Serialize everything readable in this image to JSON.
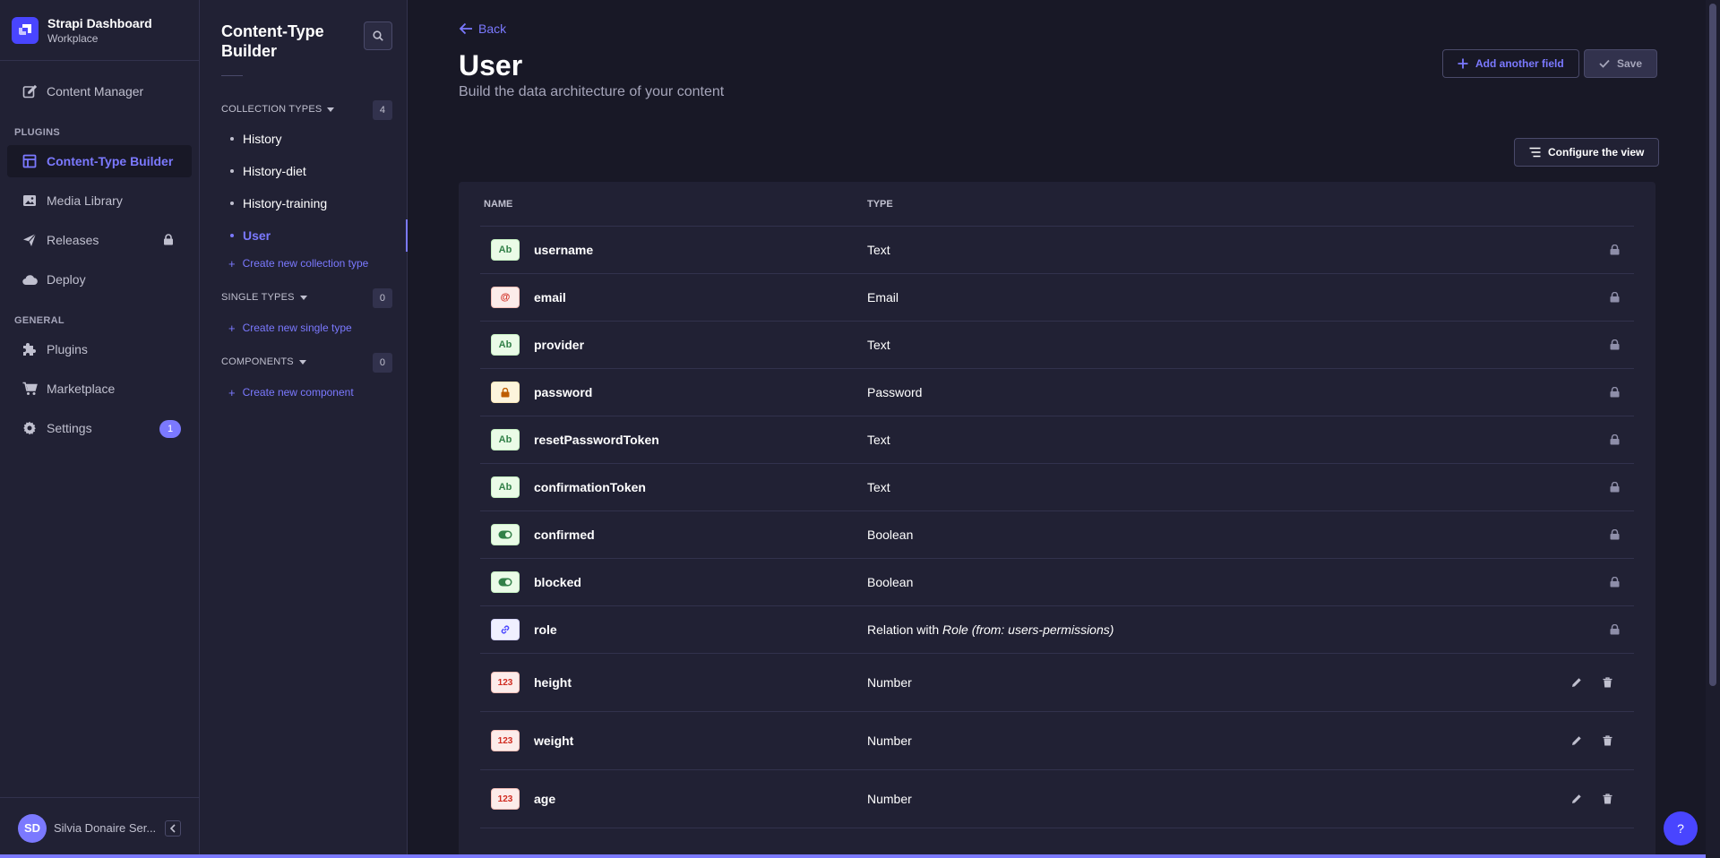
{
  "brand": {
    "title": "Strapi Dashboard",
    "subtitle": "Workplace"
  },
  "main_nav": {
    "content_manager": "Content Manager",
    "plugins_section": "PLUGINS",
    "content_type_builder": "Content-Type Builder",
    "media_library": "Media Library",
    "releases": "Releases",
    "deploy": "Deploy",
    "general_section": "GENERAL",
    "plugins": "Plugins",
    "marketplace": "Marketplace",
    "settings": "Settings",
    "settings_badge": "1"
  },
  "user": {
    "initials": "SD",
    "name": "Silvia Donaire Ser..."
  },
  "sub_nav": {
    "title": "Content-Type Builder",
    "collection_types": {
      "label": "COLLECTION TYPES",
      "count": "4",
      "items": [
        "History",
        "History-diet",
        "History-training",
        "User"
      ],
      "active": "User",
      "create_label": "Create new collection type"
    },
    "single_types": {
      "label": "SINGLE TYPES",
      "count": "0",
      "create_label": "Create new single type"
    },
    "components": {
      "label": "COMPONENTS",
      "count": "0",
      "create_label": "Create new component"
    }
  },
  "header": {
    "back": "Back",
    "title": "User",
    "subtitle": "Build the data architecture of your content",
    "add_field": "Add another field",
    "save": "Save",
    "configure_view": "Configure the view"
  },
  "table": {
    "col_name": "NAME",
    "col_type": "TYPE",
    "rows": [
      {
        "badge": "Ab",
        "kind": "text",
        "name": "username",
        "type": "Text"
      },
      {
        "badge": "@",
        "kind": "email",
        "name": "email",
        "type": "Email"
      },
      {
        "badge": "Ab",
        "kind": "text",
        "name": "provider",
        "type": "Text"
      },
      {
        "badge": "lock",
        "kind": "password",
        "name": "password",
        "type": "Password"
      },
      {
        "badge": "Ab",
        "kind": "text",
        "name": "resetPasswordToken",
        "type": "Text"
      },
      {
        "badge": "Ab",
        "kind": "text",
        "name": "confirmationToken",
        "type": "Text"
      },
      {
        "badge": "toggle",
        "kind": "boolean",
        "name": "confirmed",
        "type": "Boolean"
      },
      {
        "badge": "toggle",
        "kind": "boolean",
        "name": "blocked",
        "type": "Boolean"
      },
      {
        "badge": "link",
        "kind": "relation",
        "name": "role",
        "type_prefix": "Relation with ",
        "type_target": "Role (from: users-permissions)"
      },
      {
        "badge": "123",
        "kind": "number",
        "name": "height",
        "type": "Number"
      },
      {
        "badge": "123",
        "kind": "number",
        "name": "weight",
        "type": "Number"
      },
      {
        "badge": "123",
        "kind": "number",
        "name": "age",
        "type": "Number"
      }
    ]
  },
  "help": "?",
  "colors": {
    "accent": "#7b79ff",
    "primary": "#4945ff",
    "background": "#181826",
    "surface": "#212134"
  }
}
